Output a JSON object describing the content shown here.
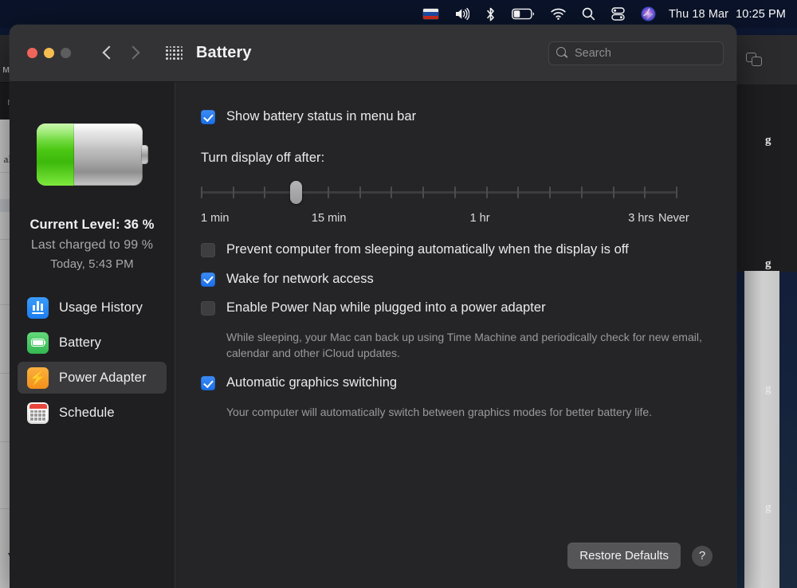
{
  "menubar": {
    "icons": [
      {
        "name": "input-source-flag-icon",
        "label": "RU"
      },
      {
        "name": "volume-icon",
        "label": "🔊"
      },
      {
        "name": "bluetooth-icon",
        "label": "✶"
      },
      {
        "name": "battery-icon",
        "label": "battery"
      },
      {
        "name": "wifi-icon",
        "label": "wifi"
      },
      {
        "name": "spotlight-search-icon",
        "label": "search"
      },
      {
        "name": "control-center-icon",
        "label": "toggles"
      },
      {
        "name": "siri-icon",
        "label": "siri"
      }
    ],
    "date": "Thu 18 Mar",
    "time": "10:25 PM"
  },
  "window": {
    "title": "Battery",
    "traffic_lights": [
      "close",
      "minimize",
      "zoom"
    ],
    "back_icon": "chevron-left-icon",
    "forward_icon": "chevron-right-icon",
    "grid_icon": "show-all-grid-icon"
  },
  "search": {
    "placeholder": "Search",
    "value": "",
    "icon": "search-icon"
  },
  "sidebar": {
    "battery_graphic": {
      "fill_percent": 36
    },
    "current_level": "Current Level: 36 %",
    "last_charged": "Last charged to 99 %",
    "last_charged_time": "Today, 5:43 PM",
    "items": [
      {
        "label": "Usage History",
        "icon": "usage-history-icon",
        "selected": false
      },
      {
        "label": "Battery",
        "icon": "battery-icon",
        "selected": false
      },
      {
        "label": "Power Adapter",
        "icon": "power-adapter-icon",
        "selected": true
      },
      {
        "label": "Schedule",
        "icon": "schedule-calendar-icon",
        "selected": false
      }
    ]
  },
  "main": {
    "show_battery_status": {
      "label": "Show battery status in menu bar",
      "checked": true
    },
    "slider": {
      "label": "Turn display off after:",
      "ticks": 16,
      "value_index": 3,
      "tick_labels": [
        {
          "text": "1 min",
          "index": 0
        },
        {
          "text": "15 min",
          "index": 4
        },
        {
          "text": "1 hr",
          "index": 9
        },
        {
          "text": "3 hrs",
          "index": 14
        },
        {
          "text": "Never",
          "index": 15
        }
      ]
    },
    "options": [
      {
        "label": "Prevent computer from sleeping automatically when the display is off",
        "checked": false,
        "help": ""
      },
      {
        "label": "Wake for network access",
        "checked": true,
        "help": ""
      },
      {
        "label": "Enable Power Nap while plugged into a power adapter",
        "checked": false,
        "help": "While sleeping, your Mac can back up using Time Machine and periodically check for new email, calendar and other iCloud updates."
      },
      {
        "label": "Automatic graphics switching",
        "checked": true,
        "help": "Your computer will automatically switch between graphics modes for better battery life."
      }
    ],
    "restore_defaults": "Restore Defaults",
    "help_button": "?"
  },
  "background": {
    "left_window_title": "мЛ",
    "left_window_sub": "m",
    "left_doc_lines": [
      "К",
      "аМ",
      "о.",
      "vё"
    ],
    "right_fragments": [
      "g",
      "g",
      "g",
      "g"
    ]
  },
  "colors": {
    "accent": "#2f7cf0",
    "selected_row": "#3a3a3c",
    "window_bg": "#232325",
    "sidebar_bg": "#1f1f21",
    "battery_green": "#4ecc1a"
  }
}
